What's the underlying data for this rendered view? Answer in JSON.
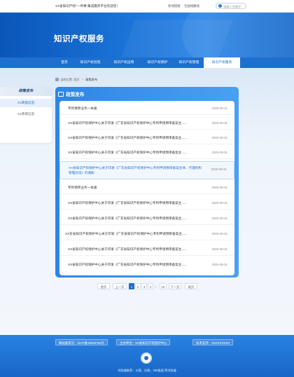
{
  "topbar": {
    "welcome": "XX省知识产权\"一件事\"集成服务平台欢迎您！",
    "links": [
      "各地链接",
      "全国线路线"
    ],
    "search_placeholder": "请输入关键字"
  },
  "banner": {
    "title": "知识产权服务"
  },
  "nav": {
    "items": [
      "首页",
      "知识产权创造",
      "知识产权运用",
      "知识产权保护",
      "知识产权管理",
      "知识产权服务"
    ],
    "active_index": 5
  },
  "breadcrumb": {
    "home": "当前位置:",
    "sep": ">",
    "level1": "首页",
    "current": "政策发布"
  },
  "sidebar": {
    "title": "政策发布",
    "items": [
      "XX政策信息",
      "XX政策信息"
    ],
    "active_index": 0
  },
  "panel": {
    "title": "政策发布",
    "rows": [
      {
        "title": "专利预审业务一本通",
        "date": "2020-08-31"
      },
      {
        "title": "XX省知识产权保护中心关于印发《广东省知识产权保护中心专利申请预审备案主......",
        "date": "2020-08-31"
      },
      {
        "title": "XX省知识产权保护中心关于印发《广东省知识产权保护中心专利申请预审备案主......",
        "date": "2020-08-31"
      },
      {
        "title": "XX省知识产权保护中心关于印发《广东省知识产权保护中心专利申请预审备案主......",
        "date": "2020-08-31"
      },
      {
        "title": "XX省知识产权保护中心关于印发《广东省知识产权保护中心专利申请预审备案主体、代理机构管理办法》的通知",
        "date": "2020-08-31"
      },
      {
        "title": "专利预审业务一本通",
        "date": "2020-08-31"
      },
      {
        "title": "XX省知识产权保护中心关于印发《广东省知识产权保护中心专利申请预审备案主......",
        "date": "2020-08-31"
      },
      {
        "title": "XX省知识产权保护中心关于印发《广东省知识产权保护中心专利申请预审备案主......",
        "date": "2020-08-31"
      },
      {
        "title": "XX东省知识产权保护中心关于印发《广东省知识产权保护中心专利申请预审备案主......",
        "date": "2020-08-31"
      },
      {
        "title": "XX省知识产权保护中心关于印发《广东省知识产权保护中心专利申请预审备案主......",
        "date": "2020-08-31"
      },
      {
        "title": "XX省知识产权保护中心关于印发《广东省知识产权保护中心专利申请预审备案主......",
        "date": "2020-08-31"
      }
    ],
    "highlight_index": 4
  },
  "pager": {
    "first": "首页",
    "prev": "上一页",
    "pages": [
      "1",
      "2",
      "3",
      "4"
    ],
    "ellipsis": "...",
    "last_page": "10",
    "next": "下一页",
    "end": "尾页",
    "current": "1"
  },
  "footer": {
    "icp": "网站备案号：XICP备19045762号",
    "host": "主办单位：XX省知识产权保护中心",
    "support": "技术支持：XXXXXXXXX",
    "note": "浏览器推荐：火狐，谷歌，360极速 等浏览器"
  }
}
